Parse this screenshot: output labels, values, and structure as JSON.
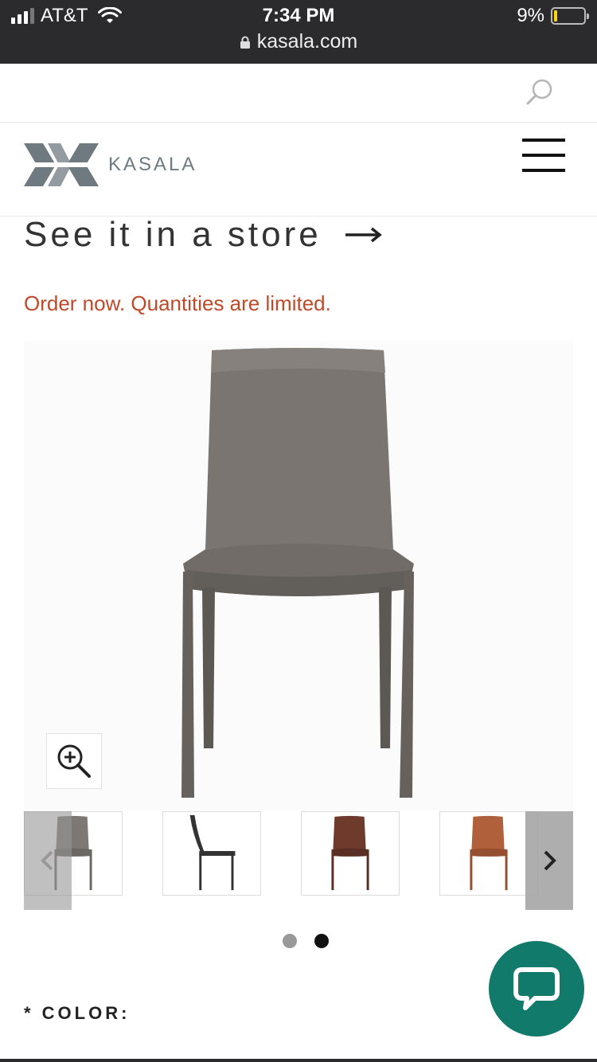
{
  "status_bar": {
    "carrier": "AT&T",
    "time": "7:34 PM",
    "url": "kasala.com",
    "battery": "9%"
  },
  "header": {
    "logo_text": "KASALA"
  },
  "store_link": {
    "label": "See it in a store"
  },
  "notice": "Order now. Quantities are limited.",
  "gallery": {
    "dots": {
      "count": 2,
      "active": 2
    },
    "thumbnails": [
      {
        "name": "gray chair front",
        "color": "#7d7874"
      },
      {
        "name": "black chair side",
        "color": "#333333"
      },
      {
        "name": "brown chair front",
        "color": "#6e3a2c"
      },
      {
        "name": "cognac chair front",
        "color": "#b0603a"
      }
    ]
  },
  "product_option": {
    "label": "* COLOR:"
  },
  "colors": {
    "notice": "#c0492a",
    "chat_button": "#127a6a",
    "status_bar": "#2b2b2d"
  },
  "icons": {
    "search": "search-icon",
    "menu": "hamburger-menu-icon",
    "arrow": "arrow-right-icon",
    "zoom": "zoom-in-icon",
    "prev": "chevron-left-icon",
    "next": "chevron-right-icon",
    "chat": "chat-bubble-icon"
  }
}
